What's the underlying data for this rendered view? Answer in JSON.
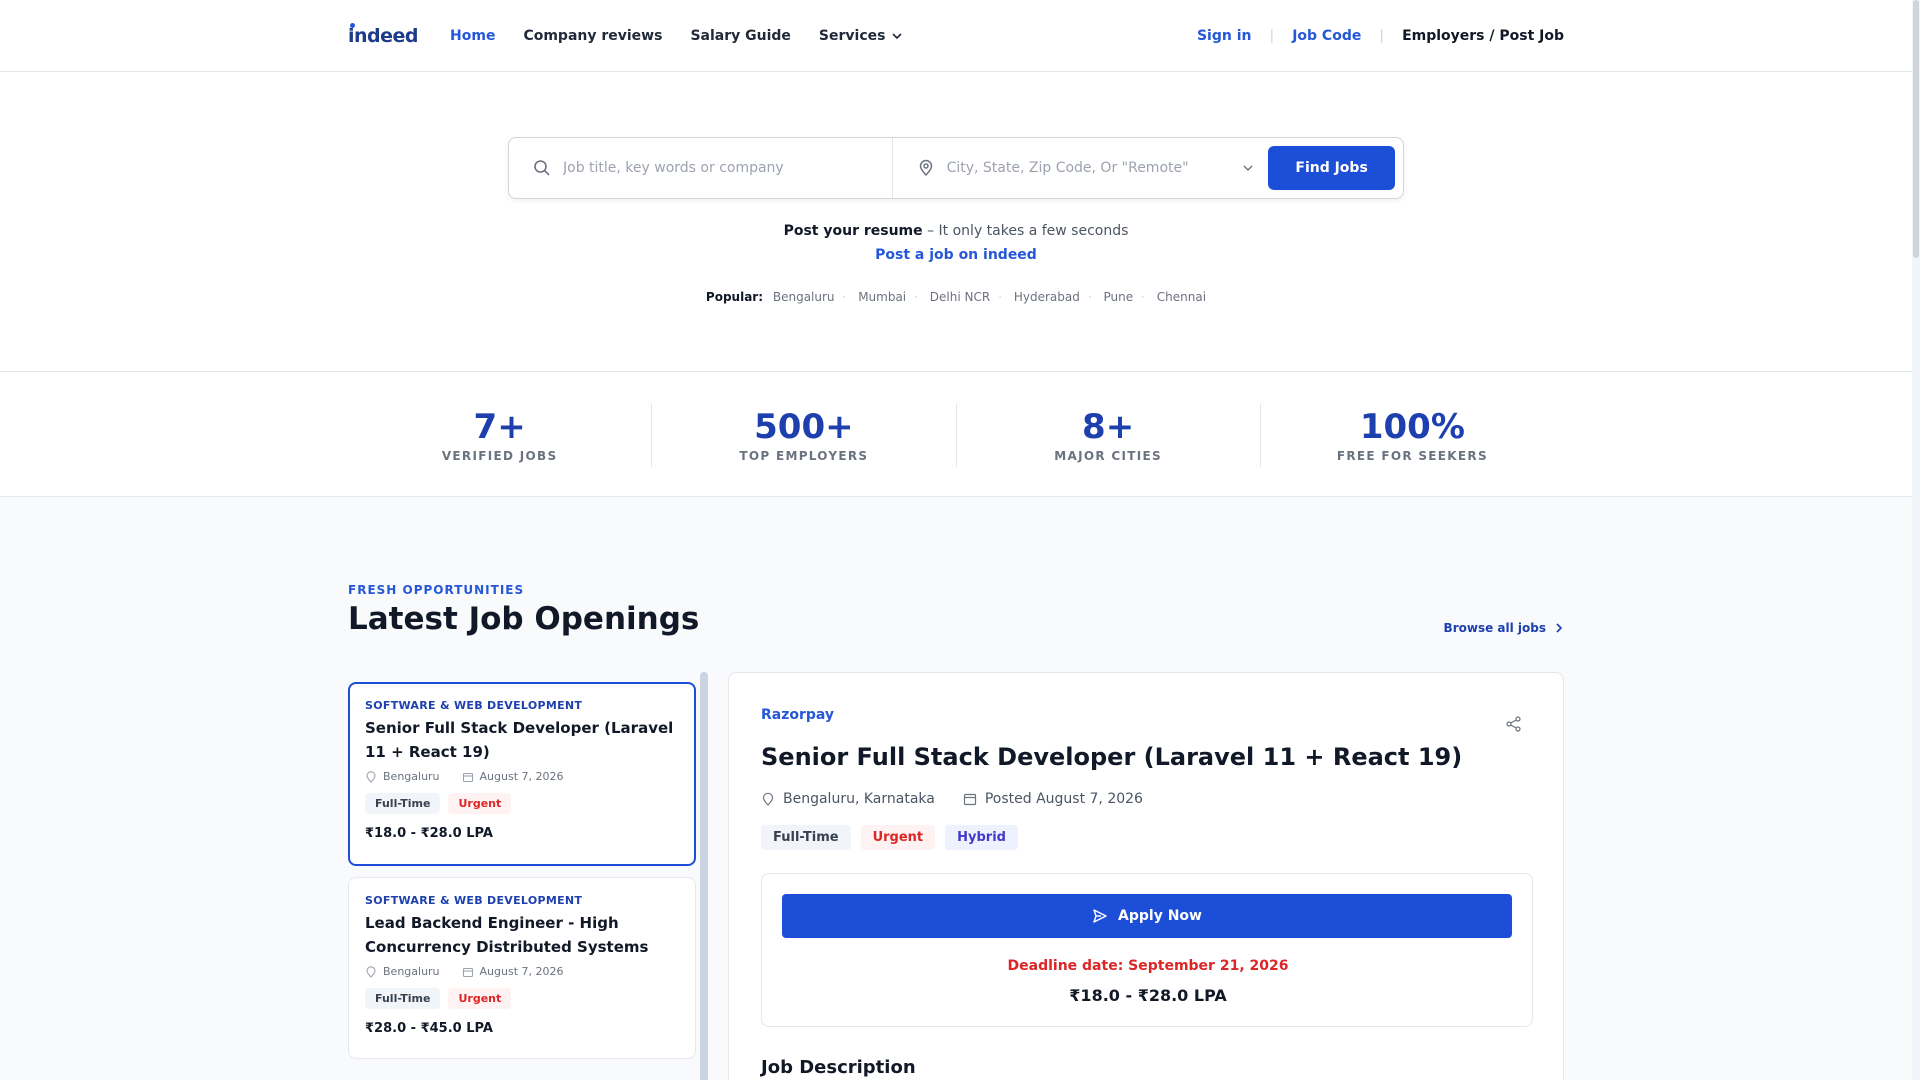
{
  "brand": {
    "logo_text": "indeed"
  },
  "nav": {
    "items": [
      "Home",
      "Company reviews",
      "Salary Guide",
      "Services"
    ],
    "sign_in": "Sign in",
    "job_code": "Job Code",
    "employers": "Employers / Post Job"
  },
  "search": {
    "what_placeholder": "Job title, key words or company",
    "where_placeholder": "City, State, Zip Code, Or \"Remote\"",
    "button": "Find Jobs"
  },
  "hero": {
    "resume_bold": "Post your resume",
    "resume_rest": " – It only takes a few seconds",
    "post_link": "Post a job on indeed",
    "popular_label": "Popular:",
    "popular_cities": [
      "Bengaluru",
      "Mumbai",
      "Delhi NCR",
      "Hyderabad",
      "Pune",
      "Chennai"
    ]
  },
  "stats": [
    {
      "value": "7+",
      "label": "VERIFIED JOBS"
    },
    {
      "value": "500+",
      "label": "TOP EMPLOYERS"
    },
    {
      "value": "8+",
      "label": "MAJOR CITIES"
    },
    {
      "value": "100%",
      "label": "FREE FOR SEEKERS"
    }
  ],
  "section": {
    "eyebrow": "FRESH OPPORTUNITIES",
    "title": "Latest Job Openings",
    "browse": "Browse all jobs"
  },
  "jobs": [
    {
      "category": "SOFTWARE & WEB DEVELOPMENT",
      "title": "Senior Full Stack Developer (Laravel 11 + React 19)",
      "location": "Bengaluru",
      "date": "August 7, 2026",
      "tags": [
        "Full-Time",
        "Urgent"
      ],
      "salary": "₹18.0 - ₹28.0 LPA"
    },
    {
      "category": "SOFTWARE & WEB DEVELOPMENT",
      "title": "Lead Backend Engineer - High Concurrency Distributed Systems",
      "location": "Bengaluru",
      "date": "August 7, 2026",
      "tags": [
        "Full-Time",
        "Urgent"
      ],
      "salary": "₹28.0 - ₹45.0 LPA"
    }
  ],
  "detail": {
    "company": "Razorpay",
    "title": "Senior Full Stack Developer (Laravel 11 + React 19)",
    "location": "Bengaluru, Karnataka",
    "posted": "Posted August 7, 2026",
    "tags": [
      "Full-Time",
      "Urgent",
      "Hybrid"
    ],
    "apply": "Apply Now",
    "deadline": "Deadline date: September 21, 2026",
    "salary": "₹18.0 - ₹28.0 LPA",
    "description_heading": "Job Description"
  },
  "colors": {
    "primary": "#1d4ed8",
    "link": "#2557d6",
    "urgent": "#dc2626",
    "hybrid": "#4338ca"
  }
}
